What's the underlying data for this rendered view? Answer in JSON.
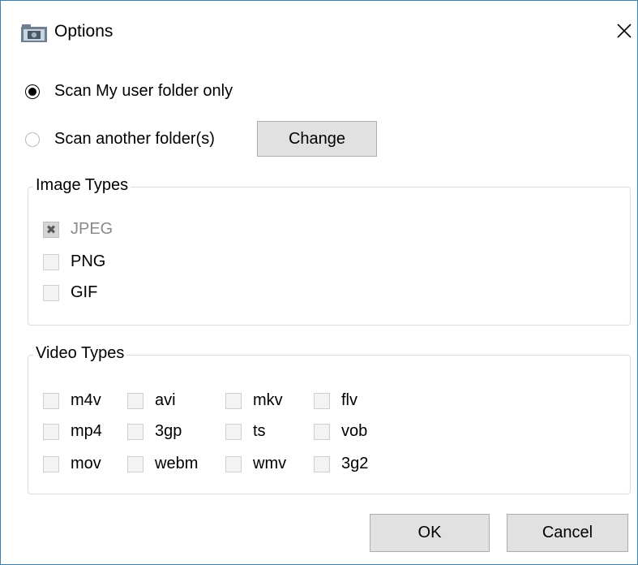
{
  "window": {
    "title": "Options",
    "app_icon": "camera-folder-icon",
    "close_icon": "close-icon",
    "accent": "#3c7fb1"
  },
  "scan": {
    "option_user_folder": {
      "label": "Scan My user folder only",
      "checked": true
    },
    "option_other_folder": {
      "label": "Scan another folder(s)",
      "checked": false
    },
    "change_label": "Change"
  },
  "image_types": {
    "legend": "Image Types",
    "items": [
      {
        "label": "JPEG",
        "checked": true,
        "disabled": true
      },
      {
        "label": "PNG",
        "checked": false,
        "disabled": false
      },
      {
        "label": "GIF",
        "checked": false,
        "disabled": false
      }
    ]
  },
  "video_types": {
    "legend": "Video Types",
    "items": [
      {
        "label": "m4v",
        "checked": false
      },
      {
        "label": "avi",
        "checked": false
      },
      {
        "label": "mkv",
        "checked": false
      },
      {
        "label": "flv",
        "checked": false
      },
      {
        "label": "mp4",
        "checked": false
      },
      {
        "label": "3gp",
        "checked": false
      },
      {
        "label": "ts",
        "checked": false
      },
      {
        "label": "vob",
        "checked": false
      },
      {
        "label": "mov",
        "checked": false
      },
      {
        "label": "webm",
        "checked": false
      },
      {
        "label": "wmv",
        "checked": false
      },
      {
        "label": "3g2",
        "checked": false
      }
    ]
  },
  "footer": {
    "ok_label": "OK",
    "cancel_label": "Cancel"
  }
}
